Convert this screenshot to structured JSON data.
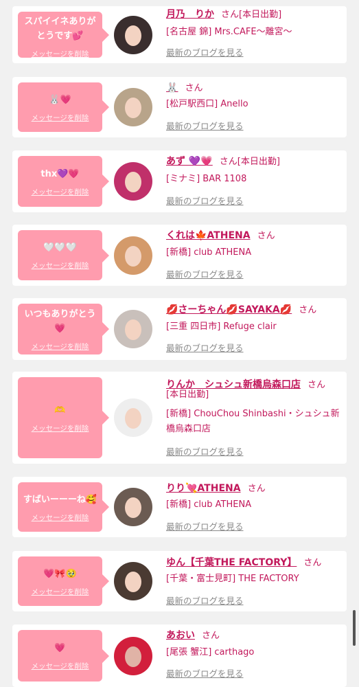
{
  "delete_label": "メッセージを削除",
  "blog_label": "最新のブログを見る",
  "honorific": "さん",
  "entries": [
    {
      "message": "スパイイネありがとうです💕",
      "name": "月乃　りか",
      "status": "[本日出勤]",
      "shop": "[名古屋 錦] Mrs.CAFE～離宮～"
    },
    {
      "message": "🐰💗",
      "name": "🐰",
      "status": "",
      "shop": "[松戸駅西口] Anello"
    },
    {
      "message": "thx💜💗",
      "name": "あず 💜💗",
      "status": "[本日出勤]",
      "shop": "[ミナミ] BAR 1108"
    },
    {
      "message": "🤍🤍🤍",
      "name": "くれは🍁ATHENA",
      "status": "",
      "shop": "[新橋] club ATHENA"
    },
    {
      "message": "いつもありがとう💗",
      "name": "💋さーちゃん💋SAYAKA💋",
      "status": "",
      "shop": "[三重 四日市] Refuge clair"
    },
    {
      "message": "🫶",
      "name": "りんか　シュシュ新橋烏森口店",
      "status": "[本日出勤]",
      "shop": "[新橋] ChouChou Shinbashi・シュシュ新橋烏森口店"
    },
    {
      "message": "すばいーーーね🥰",
      "name": "りり💘ATHENA",
      "status": "",
      "shop": "[新橋] club ATHENA"
    },
    {
      "message": "💗🎀🥹",
      "name": "ゆん【千葉THE FACTORY】",
      "status": "",
      "shop": "[千葉・富士見町] THE FACTORY"
    },
    {
      "message": "💗",
      "name": "あおい",
      "status": "",
      "shop": "[尾張 蟹江] carthago"
    }
  ],
  "avatar_colors": [
    "#3a2e2e",
    "#b8a48a",
    "#c0306a",
    "#d49a6a",
    "#c9c0bb",
    "#eeeeee",
    "#6b5b52",
    "#4a3a32",
    "#d21f3c"
  ]
}
